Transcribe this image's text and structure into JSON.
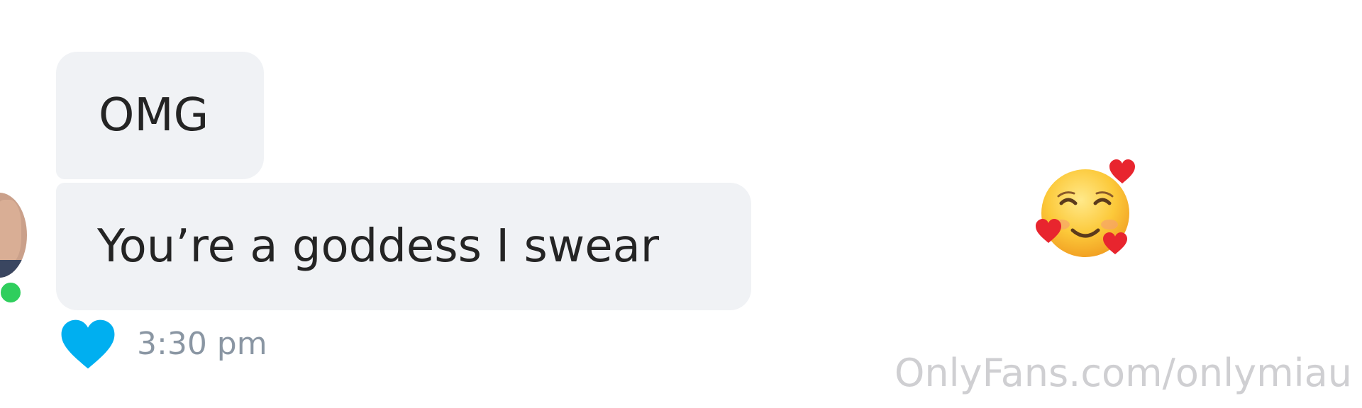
{
  "messages": [
    {
      "text": "OMG"
    },
    {
      "text": "You’re a goddess I swear"
    }
  ],
  "meta": {
    "time": "3:30 pm",
    "liked": true,
    "like_color": "#00aff0"
  },
  "reaction_emoji": "smiling-face-with-hearts-icon",
  "sender": {
    "online": true,
    "status_color": "#2fce5d"
  },
  "watermark": "OnlyFans.com/onlymiau",
  "colors": {
    "bubble_bg": "#f0f2f5",
    "message_text": "#242424",
    "time_text": "#8a96a3"
  }
}
